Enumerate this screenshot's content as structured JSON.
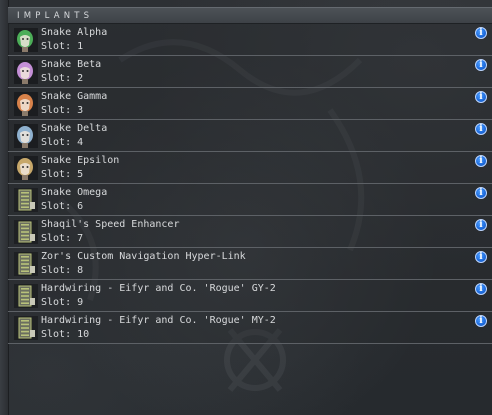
{
  "panel": {
    "title": "IMPLANTS"
  },
  "implants": [
    {
      "name": "Snake Alpha",
      "slot": "Slot: 1",
      "icon": "head-implant-icon",
      "tint": "#4cae58"
    },
    {
      "name": "Snake Beta",
      "slot": "Slot: 2",
      "icon": "head-implant-icon",
      "tint": "#c48fd6"
    },
    {
      "name": "Snake Gamma",
      "slot": "Slot: 3",
      "icon": "head-implant-icon",
      "tint": "#d8824a"
    },
    {
      "name": "Snake Delta",
      "slot": "Slot: 4",
      "icon": "head-implant-icon",
      "tint": "#8fb1cf"
    },
    {
      "name": "Snake Epsilon",
      "slot": "Slot: 5",
      "icon": "head-implant-icon",
      "tint": "#c7a86a"
    },
    {
      "name": "Snake Omega",
      "slot": "Slot: 6",
      "icon": "hardwiring-chip-icon",
      "tint": "#b8c27a"
    },
    {
      "name": "Shaqil's Speed Enhancer",
      "slot": "Slot: 7",
      "icon": "hardwiring-chip-icon",
      "tint": "#b8c27a"
    },
    {
      "name": "Zor's Custom Navigation Hyper-Link",
      "slot": "Slot: 8",
      "icon": "hardwiring-chip-icon",
      "tint": "#b8c27a"
    },
    {
      "name": "Hardwiring - Eifyr and Co. 'Rogue' GY-2",
      "slot": "Slot: 9",
      "icon": "hardwiring-chip-icon",
      "tint": "#b8c27a"
    },
    {
      "name": "Hardwiring - Eifyr and Co. 'Rogue' MY-2",
      "slot": "Slot: 10",
      "icon": "hardwiring-chip-icon",
      "tint": "#b8c27a"
    }
  ],
  "info_button": {
    "glyph": "i",
    "icon": "info-icon",
    "color": "#1f6ee0"
  }
}
